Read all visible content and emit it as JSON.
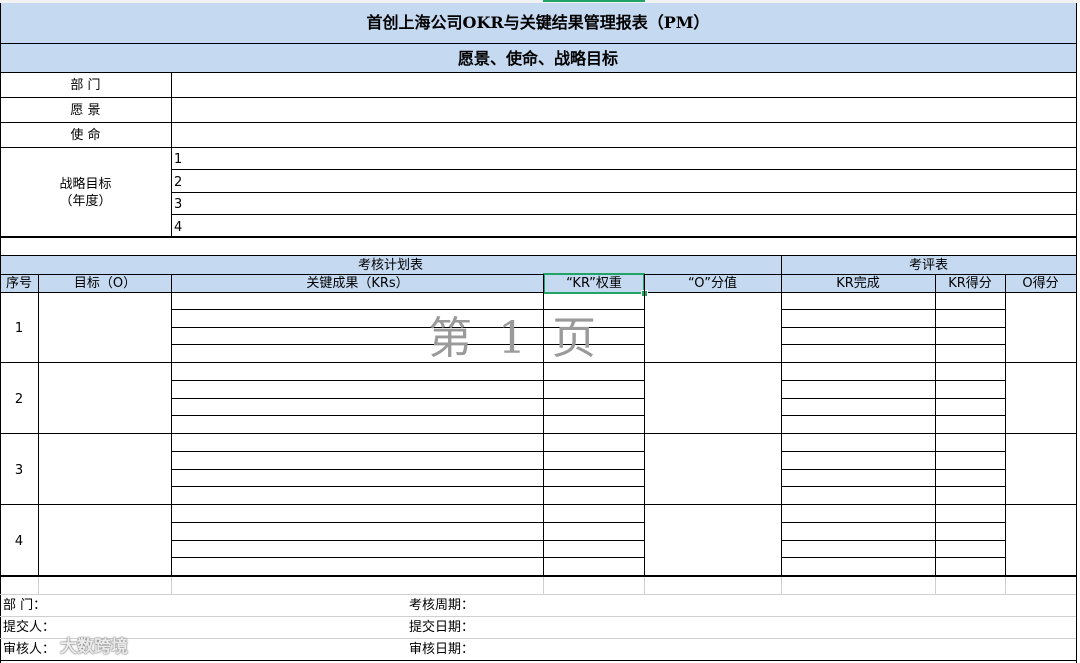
{
  "report": {
    "title": "首创上海公司OKR与关键结果管理报表（PM）",
    "section_title": "愿景、使命、战略目标",
    "dept_label": "部  门",
    "vision_label": "愿  景",
    "mission_label": "使  命",
    "strategy_label_1": "战略目标",
    "strategy_label_2": "（年度）",
    "strategy_rows": [
      "1",
      "2",
      "3",
      "4"
    ]
  },
  "plan_table": {
    "group_plan": "考核计划表",
    "group_eval": "考评表",
    "headers": {
      "seq": "序号",
      "objective": "目标（O）",
      "key_results": "关键成果（KRs）",
      "kr_weight": "“KR”权重",
      "o_score": "“O”分值",
      "kr_done": "KR完成",
      "kr_score": "KR得分",
      "o_points": "O得分"
    },
    "rows": [
      "1",
      "2",
      "3",
      "4"
    ]
  },
  "watermark": "第 1 页",
  "footer": {
    "dept": "部  门：",
    "submitter": "提交人：",
    "reviewer": "审核人：",
    "period": "考核周期：",
    "submit_date": "提交日期：",
    "review_date": "审核日期："
  },
  "logo_text": "大数跨境",
  "colors": {
    "header_fill": "#c5d9f1",
    "selection": "#21a366"
  }
}
